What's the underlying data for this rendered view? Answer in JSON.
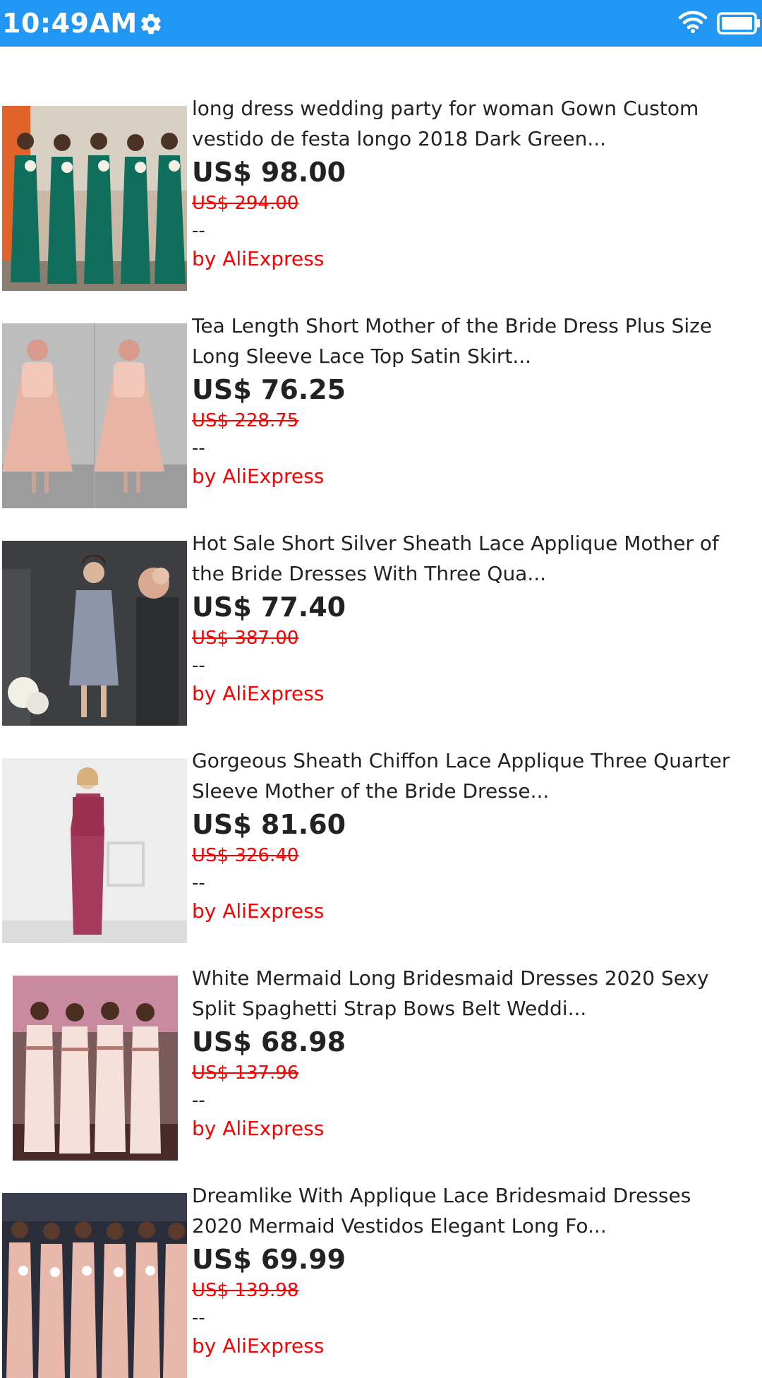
{
  "status_bar": {
    "time": "10:49AM",
    "icons": [
      "gear-icon",
      "wifi-icon",
      "battery-icon"
    ],
    "background": "#2196f3"
  },
  "products": [
    {
      "title_line1": "long dress wedding party for woman Gown Custom",
      "title_line2": "vestido de festa longo 2018 Dark Green...",
      "price": "US$ 98.00",
      "original_price": "US$ 294.00",
      "rating": "--",
      "seller": "by AliExpress"
    },
    {
      "title_line1": "Tea Length Short Mother of the Bride Dress Plus Size",
      "title_line2": "Long Sleeve Lace Top Satin Skirt...",
      "price": "US$ 76.25",
      "original_price": "US$ 228.75",
      "rating": "--",
      "seller": "by AliExpress"
    },
    {
      "title_line1": "Hot Sale Short Silver Sheath Lace Applique Mother of",
      "title_line2": "the Bride Dresses With Three Qua...",
      "price": "US$ 77.40",
      "original_price": "US$ 387.00",
      "rating": "--",
      "seller": "by AliExpress"
    },
    {
      "title_line1": "Gorgeous Sheath Chiffon Lace Applique Three Quarter",
      "title_line2": "Sleeve Mother of the Bride Dresse...",
      "price": "US$ 81.60",
      "original_price": "US$ 326.40",
      "rating": "--",
      "seller": "by AliExpress"
    },
    {
      "title_line1": "White Mermaid Long Bridesmaid Dresses 2020 Sexy",
      "title_line2": "Split Spaghetti Strap Bows Belt Weddi...",
      "price": "US$ 68.98",
      "original_price": "US$ 137.96",
      "rating": "--",
      "seller": "by AliExpress"
    },
    {
      "title_line1": "Dreamlike With Applique Lace Bridesmaid Dresses",
      "title_line2": "2020 Mermaid Vestidos Elegant Long Fo...",
      "price": "US$ 69.99",
      "original_price": "US$ 139.98",
      "rating": "--",
      "seller": "by AliExpress"
    }
  ],
  "colors": {
    "price_text": "#222222",
    "original_price": "#ff0000",
    "seller": "#ff0000"
  }
}
